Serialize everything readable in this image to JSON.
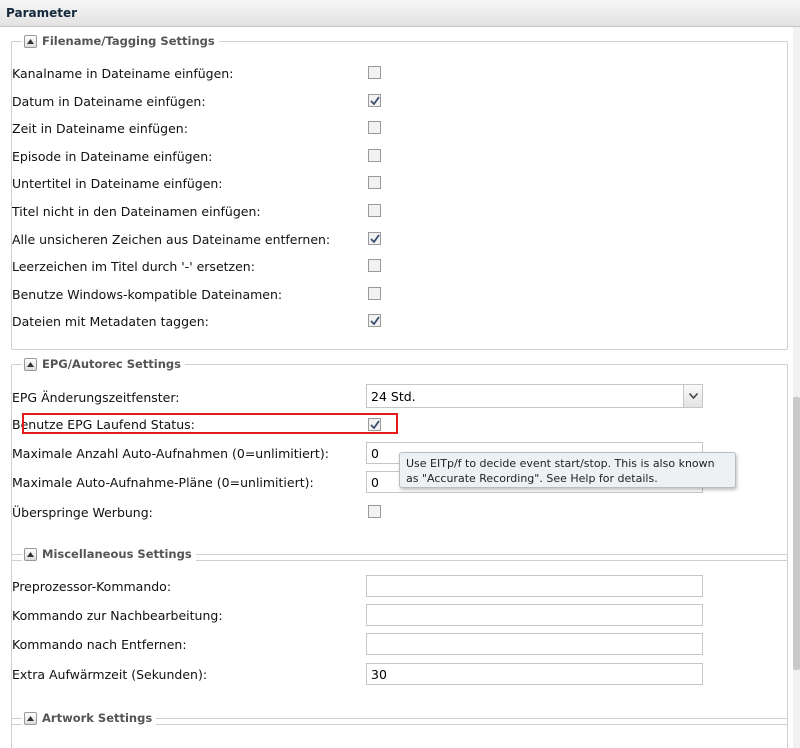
{
  "header": {
    "title": "Parameter"
  },
  "sections": {
    "filename": {
      "legend": "Filename/Tagging Settings",
      "items": [
        {
          "label": "Kanalname in Dateiname einfügen:",
          "checked": false
        },
        {
          "label": "Datum in Dateiname einfügen:",
          "checked": true
        },
        {
          "label": "Zeit in Dateiname einfügen:",
          "checked": false
        },
        {
          "label": "Episode in Dateiname einfügen:",
          "checked": false
        },
        {
          "label": "Untertitel in Dateiname einfügen:",
          "checked": false
        },
        {
          "label": "Titel nicht in den Dateinamen einfügen:",
          "checked": false
        },
        {
          "label": "Alle unsicheren Zeichen aus Dateiname entfernen:",
          "checked": true
        },
        {
          "label": "Leerzeichen im Titel durch '-' ersetzen:",
          "checked": false
        },
        {
          "label": "Benutze Windows-kompatible Dateinamen:",
          "checked": false
        },
        {
          "label": "Dateien mit Metadaten taggen:",
          "checked": true
        }
      ]
    },
    "epg": {
      "legend": "EPG/Autorec Settings",
      "window_label": "EPG Änderungszeitfenster:",
      "window_value": "24 Std.",
      "running_status_label": "Benutze EPG Laufend Status:",
      "running_status_checked": true,
      "max_autorec_label": "Maximale Anzahl Auto-Aufnahmen (0=unlimitiert):",
      "max_autorec_value": "0",
      "max_plans_label": "Maximale Auto-Aufnahme-Pläne (0=unlimitiert):",
      "max_plans_value": "0",
      "skip_ads_label": "Überspringe Werbung:",
      "skip_ads_checked": false,
      "tooltip": "Use EITp/f to decide event start/stop. This is also known as \"Accurate Recording\". See Help for details."
    },
    "misc": {
      "legend": "Miscellaneous Settings",
      "preprocessor_label": "Preprozessor-Kommando:",
      "preprocessor_value": "",
      "postprocessor_label": "Kommando zur Nachbearbeitung:",
      "postprocessor_value": "",
      "remove_cmd_label": "Kommando nach Entfernen:",
      "remove_cmd_value": "",
      "warmup_label": "Extra Aufwärmzeit (Sekunden):",
      "warmup_value": "30"
    },
    "artwork": {
      "legend": "Artwork Settings"
    }
  },
  "colors": {
    "highlight": "#e21b1b",
    "checkmark": "#3b4f6e"
  },
  "icons": {
    "collapse": "collapse-arrow-icon",
    "dropdown": "chevron-down-icon",
    "check": "checkmark-icon"
  }
}
